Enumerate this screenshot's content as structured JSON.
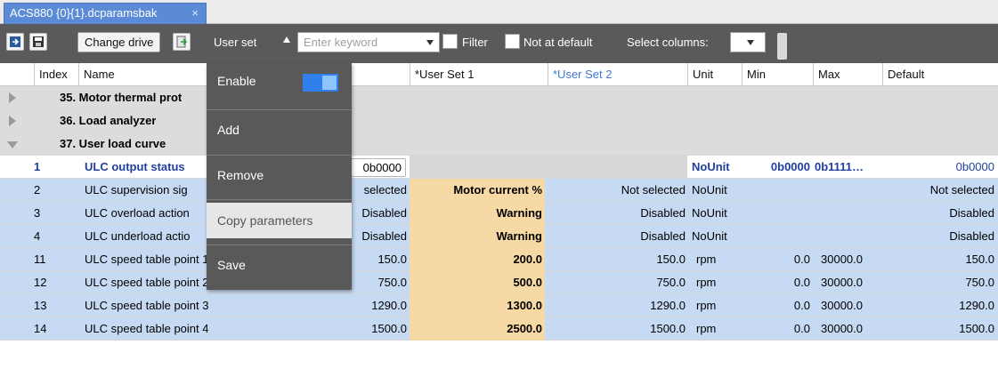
{
  "tab": {
    "title": "ACS880 {0}{1}.dcparamsbak",
    "close": "×"
  },
  "toolbar": {
    "change_drive": "Change drive",
    "user_set": "User set",
    "search_placeholder": "Enter keyword",
    "filter": "Filter",
    "not_at_default": "Not at default",
    "select_columns": "Select columns:"
  },
  "columns": {
    "index": "Index",
    "name": "Name",
    "user_set_1": "*User Set 1",
    "user_set_2": "*User Set 2",
    "unit": "Unit",
    "min": "Min",
    "max": "Max",
    "default": "Default"
  },
  "groups": [
    {
      "label": "35. Motor thermal prot",
      "expanded": false
    },
    {
      "label": "36. Load analyzer",
      "expanded": false
    },
    {
      "label": "37. User load curve",
      "expanded": true
    }
  ],
  "rows": [
    {
      "index": "1",
      "name": "ULC output status",
      "value": "0b0000",
      "us1": "",
      "us2": "",
      "unit": "NoUnit",
      "min": "0b0000",
      "max": "0b1111…",
      "default": "0b0000"
    },
    {
      "index": "2",
      "name": "ULC supervision sig",
      "value": "selected",
      "us1": "Motor current %",
      "us2": "Not selected",
      "unit": "NoUnit",
      "min": "",
      "max": "",
      "default": "Not selected"
    },
    {
      "index": "3",
      "name": "ULC overload action",
      "value": "Disabled",
      "us1": "Warning",
      "us2": "Disabled",
      "unit": "NoUnit",
      "min": "",
      "max": "",
      "default": "Disabled"
    },
    {
      "index": "4",
      "name": "ULC underload actio",
      "value": "Disabled",
      "us1": "Warning",
      "us2": "Disabled",
      "unit": "NoUnit",
      "min": "",
      "max": "",
      "default": "Disabled"
    },
    {
      "index": "11",
      "name": "ULC speed table point 1",
      "value": "150.0",
      "us1": "200.0",
      "us2": "150.0",
      "unit": "rpm",
      "min": "0.0",
      "max": "30000.0",
      "default": "150.0"
    },
    {
      "index": "12",
      "name": "ULC speed table point 2",
      "value": "750.0",
      "us1": "500.0",
      "us2": "750.0",
      "unit": "rpm",
      "min": "0.0",
      "max": "30000.0",
      "default": "750.0"
    },
    {
      "index": "13",
      "name": "ULC speed table point 3",
      "value": "1290.0",
      "us1": "1300.0",
      "us2": "1290.0",
      "unit": "rpm",
      "min": "0.0",
      "max": "30000.0",
      "default": "1290.0"
    },
    {
      "index": "14",
      "name": "ULC speed table point 4",
      "value": "1500.0",
      "us1": "2500.0",
      "us2": "1500.0",
      "unit": "rpm",
      "min": "0.0",
      "max": "30000.0",
      "default": "1500.0"
    }
  ],
  "menu": {
    "enable": "Enable",
    "enable_state": "on",
    "add": "Add",
    "remove": "Remove",
    "copy_parameters": "Copy parameters",
    "save": "Save"
  },
  "colors": {
    "toolbar_bg": "#5a5a5a",
    "tab_bg": "#5b8bd6",
    "row_highlight": "#c6daf3",
    "changed_value": "#f7d9a6",
    "toggle_on": "#2f80ed"
  }
}
